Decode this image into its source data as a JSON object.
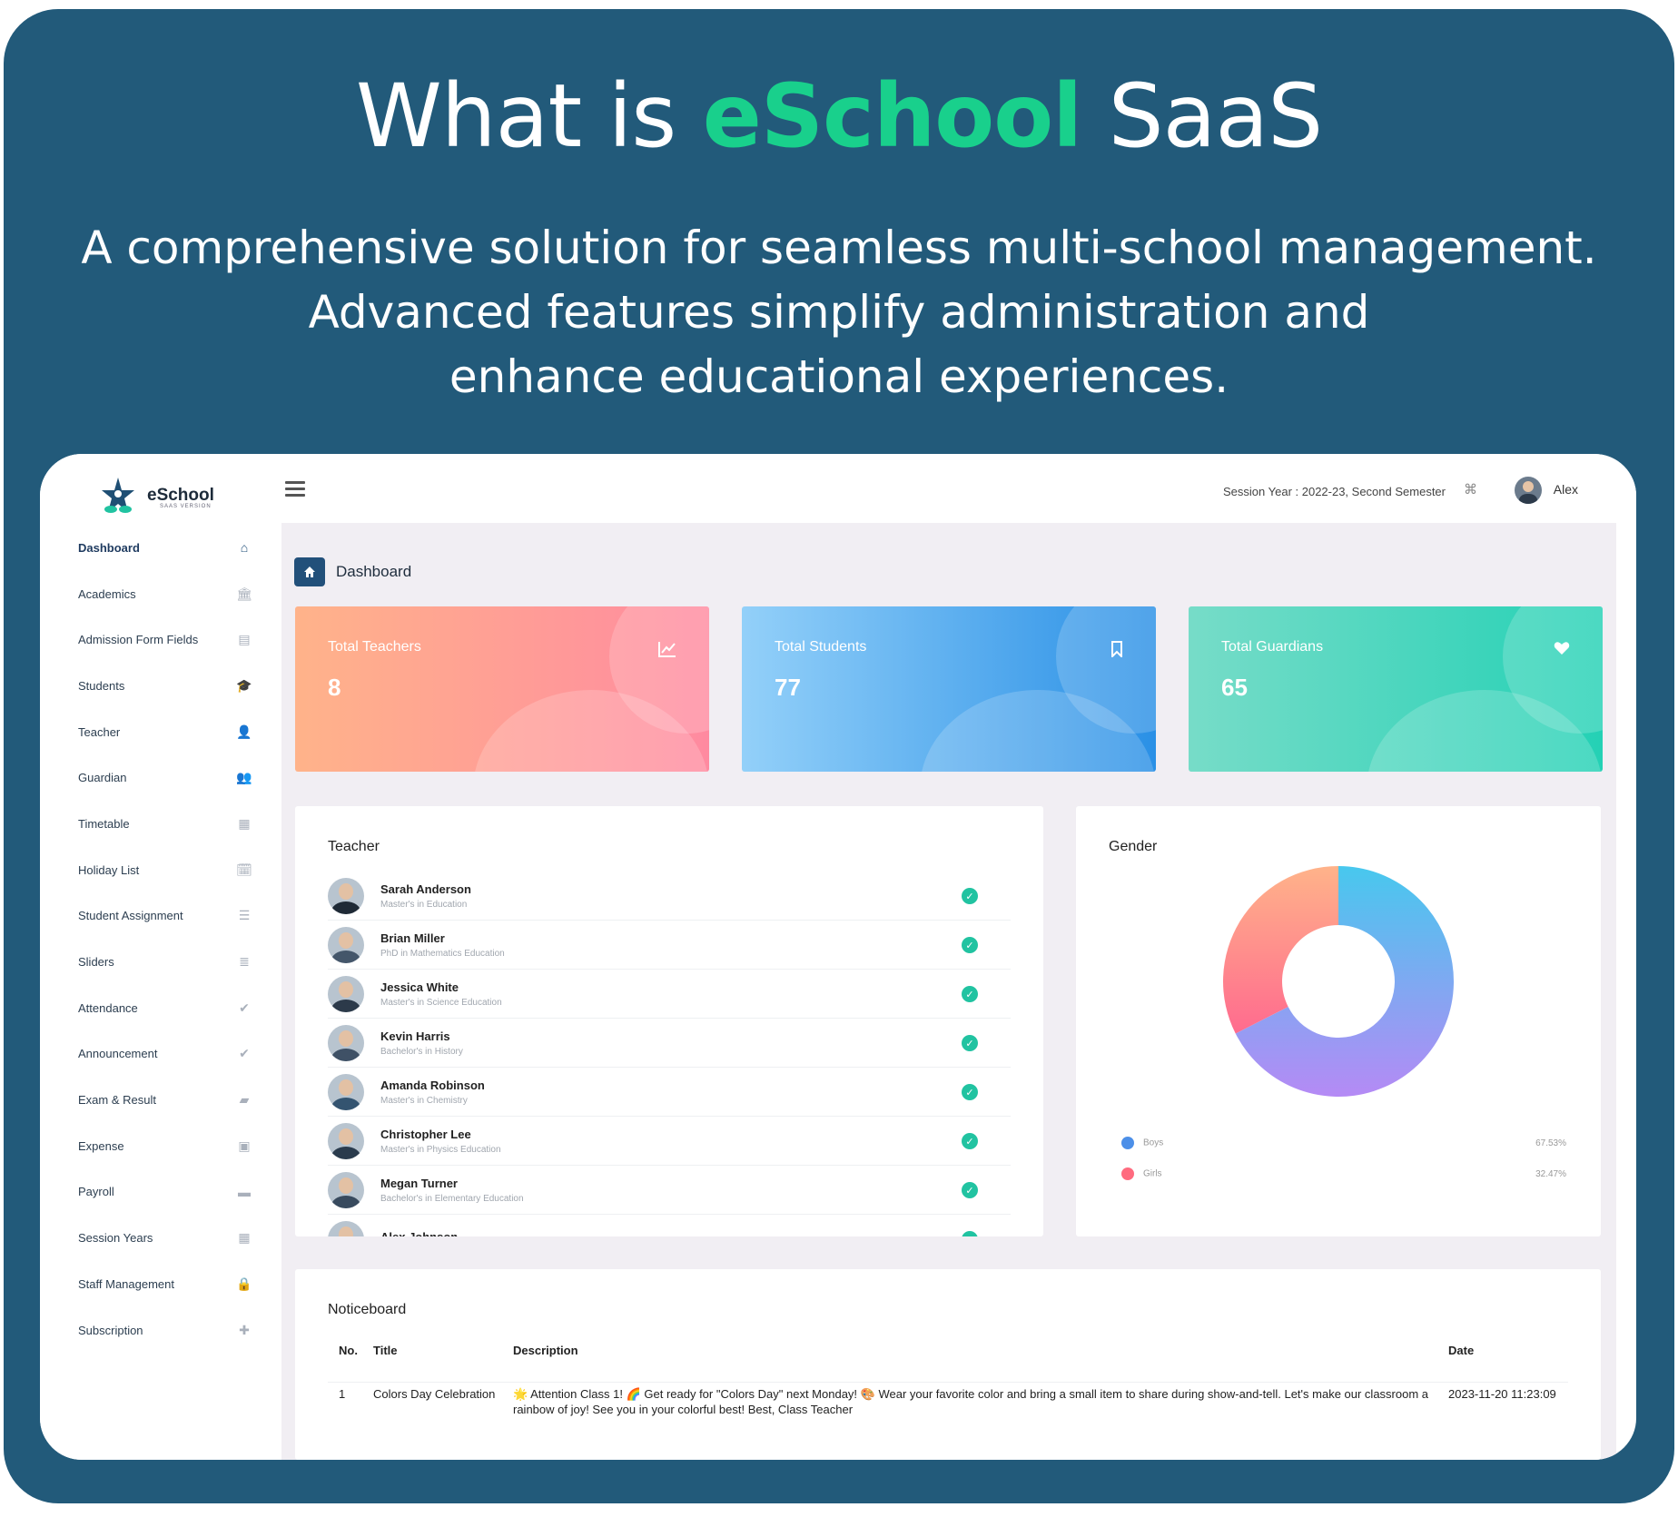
{
  "hero": {
    "title_prefix": "What is ",
    "title_accent": "eSchool",
    "title_suffix": " SaaS",
    "subtitle_lines": [
      "A comprehensive solution for seamless multi-school management.",
      "Advanced features simplify administration and",
      "enhance educational experiences."
    ]
  },
  "brand": {
    "name": "eSchool",
    "tagline": "SAAS VERSION"
  },
  "sidebar": {
    "items": [
      {
        "label": "Dashboard",
        "icon": "home-icon",
        "glyph": "⌂",
        "active": true
      },
      {
        "label": "Academics",
        "icon": "bank-icon",
        "glyph": "🏛"
      },
      {
        "label": "Admission Form Fields",
        "icon": "form-icon",
        "glyph": "▤"
      },
      {
        "label": "Students",
        "icon": "graduation-cap-icon",
        "glyph": "🎓"
      },
      {
        "label": "Teacher",
        "icon": "user-icon",
        "glyph": "👤"
      },
      {
        "label": "Guardian",
        "icon": "users-icon",
        "glyph": "👥"
      },
      {
        "label": "Timetable",
        "icon": "calendar-icon",
        "glyph": "▦"
      },
      {
        "label": "Holiday List",
        "icon": "calendar-check-icon",
        "glyph": "🗓"
      },
      {
        "label": "Student Assignment",
        "icon": "tasks-icon",
        "glyph": "☰"
      },
      {
        "label": "Sliders",
        "icon": "list-icon",
        "glyph": "≣"
      },
      {
        "label": "Attendance",
        "icon": "check-icon",
        "glyph": "✔"
      },
      {
        "label": "Announcement",
        "icon": "check-icon",
        "glyph": "✔"
      },
      {
        "label": "Exam & Result",
        "icon": "book-icon",
        "glyph": "▰"
      },
      {
        "label": "Expense",
        "icon": "money-icon",
        "glyph": "▣"
      },
      {
        "label": "Payroll",
        "icon": "credit-card-icon",
        "glyph": "▬"
      },
      {
        "label": "Session Years",
        "icon": "calendar-icon",
        "glyph": "▦"
      },
      {
        "label": "Staff Management",
        "icon": "lock-user-icon",
        "glyph": "🔒"
      },
      {
        "label": "Subscription",
        "icon": "puzzle-icon",
        "glyph": "✚"
      }
    ]
  },
  "topbar": {
    "session": "Session Year : 2022-23, Second Semester",
    "user": "Alex"
  },
  "breadcrumb": {
    "label": "Dashboard"
  },
  "stats": {
    "teachers": {
      "label": "Total Teachers",
      "value": "8",
      "icon": "chart-line-icon"
    },
    "students": {
      "label": "Total Students",
      "value": "77",
      "icon": "bookmark-icon"
    },
    "guardians": {
      "label": "Total Guardians",
      "value": "65",
      "icon": "heart-icon"
    }
  },
  "teachers": {
    "title": "Teacher",
    "list": [
      {
        "name": "Sarah Anderson",
        "qualification": "Master's in Education"
      },
      {
        "name": "Brian Miller",
        "qualification": "PhD in Mathematics Education"
      },
      {
        "name": "Jessica White",
        "qualification": "Master's in Science Education"
      },
      {
        "name": "Kevin Harris",
        "qualification": "Bachelor's in History"
      },
      {
        "name": "Amanda Robinson",
        "qualification": "Master's in Chemistry"
      },
      {
        "name": "Christopher Lee",
        "qualification": "Master's in Physics Education"
      },
      {
        "name": "Megan Turner",
        "qualification": "Bachelor's in Elementary Education"
      },
      {
        "name": "Alex Johnson",
        "qualification": ""
      }
    ]
  },
  "gender": {
    "title": "Gender",
    "boys_label": "Boys",
    "boys_pct": "67.53%",
    "girls_label": "Girls",
    "girls_pct": "32.47%",
    "boys_value": 67.53,
    "girls_value": 32.47,
    "colors": {
      "boys_start": "#47c8ee",
      "boys_end": "#b58af5",
      "girls_start": "#ff6b8e",
      "girls_end": "#ffb38a"
    }
  },
  "noticeboard": {
    "title": "Noticeboard",
    "columns": [
      "No.",
      "Title",
      "Description",
      "Date"
    ],
    "rows": [
      {
        "no": "1",
        "title": "Colors Day Celebration",
        "description": "🌟 Attention Class 1! 🌈 Get ready for \"Colors Day\" next Monday! 🎨 Wear your favorite color and bring a small item to share during show-and-tell. Let's make our classroom a rainbow of joy! See you in your colorful best! Best, Class Teacher",
        "date": "2023-11-20 11:23:09"
      }
    ]
  },
  "colors": {
    "background": "#225a7a",
    "accent": "#19d08c",
    "primary": "#22507a"
  }
}
